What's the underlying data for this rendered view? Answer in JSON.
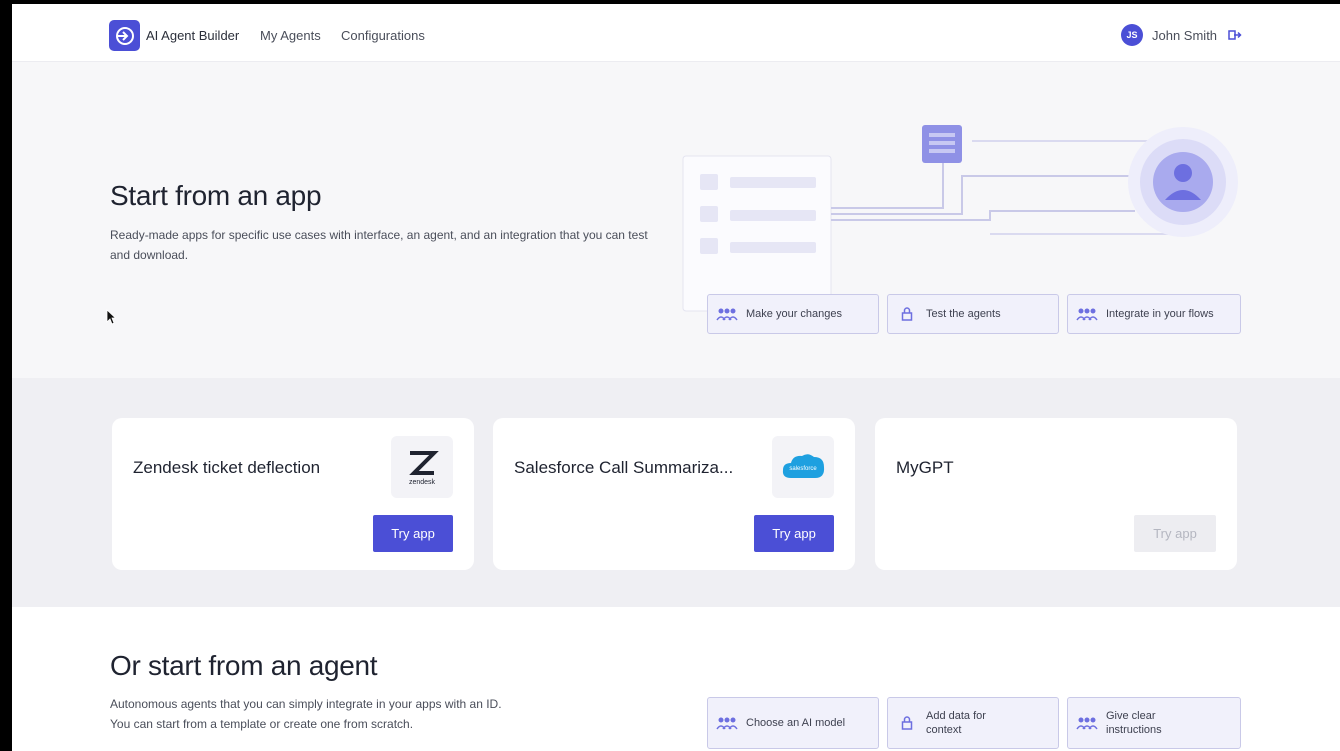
{
  "header": {
    "brand": "AI Agent Builder",
    "nav": [
      "My Agents",
      "Configurations"
    ],
    "user_initials": "JS",
    "user_name": "John Smith"
  },
  "hero": {
    "title": "Start from an app",
    "description": "Ready-made apps for specific use cases with interface, an agent, and an integration that you can test and download.",
    "pills": [
      "Make your changes",
      "Test the agents",
      "Integrate in your flows"
    ]
  },
  "apps": [
    {
      "title": "Zendesk ticket deflection",
      "logo_text": "zendesk",
      "button": "Try app",
      "enabled": true
    },
    {
      "title": "Salesforce Call Summariza...",
      "logo_text": "salesforce",
      "button": "Try app",
      "enabled": true
    },
    {
      "title": "MyGPT",
      "logo_text": "",
      "button": "Try app",
      "enabled": false
    }
  ],
  "agents": {
    "title": "Or start from an agent",
    "description_line1": "Autonomous agents that you can simply integrate in your apps with an ID.",
    "description_line2": "You can start from a template or create one from scratch.",
    "pills": [
      "Choose an AI model",
      "Add data for context",
      "Give clear instructions"
    ]
  },
  "colors": {
    "accent": "#4b4fd6",
    "page_bg": "#f7f7f9",
    "card_bg": "#ffffff",
    "pill_bg": "#f1f1fb",
    "disabled_bg": "#ededf1"
  }
}
